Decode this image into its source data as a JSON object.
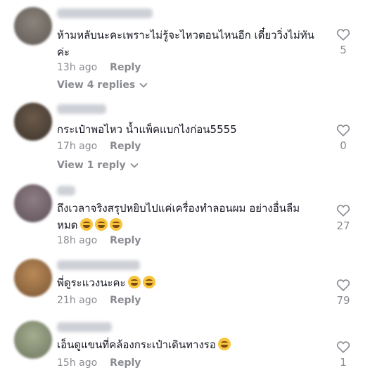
{
  "comments": [
    {
      "text": "ห้ามหลับนะคะเพราะไม่รู้จะไหวตอนไหนอีก เดี๋ยววิ่งไม่ทัน ค่ะ",
      "time": "13h ago",
      "reply": "Reply",
      "likes": "5",
      "view_replies": "View 4 replies"
    },
    {
      "text": "กระเป๋าพอไหว น้ำแพ็คแบกไงก่อน5555",
      "time": "17h ago",
      "reply": "Reply",
      "likes": "0",
      "view_replies": "View 1 reply"
    },
    {
      "text": "ถึงเวลาจริงสรุปหยิบไปแค่เครื่องทำลอนผม อย่างอื่นลืม หมด",
      "time": "18h ago",
      "reply": "Reply",
      "likes": "27",
      "emoji_count": 3
    },
    {
      "text": "พี่ดูระแวงนะคะ",
      "time": "21h ago",
      "reply": "Reply",
      "likes": "79",
      "emoji_count": 2
    },
    {
      "text": "เอ็นดูแขนที่คล้องกระเป๋าเดินทางรอ",
      "time": "15h ago",
      "reply": "Reply",
      "likes": "1",
      "emoji_count": 1
    }
  ],
  "icons": {
    "like": "heart-outline-icon",
    "expand": "chevron-down-icon",
    "emoji": "laughing-emoji-icon"
  },
  "colors": {
    "text": "#161823",
    "muted": "#8a8b91",
    "emoji": "#f7c43b"
  }
}
